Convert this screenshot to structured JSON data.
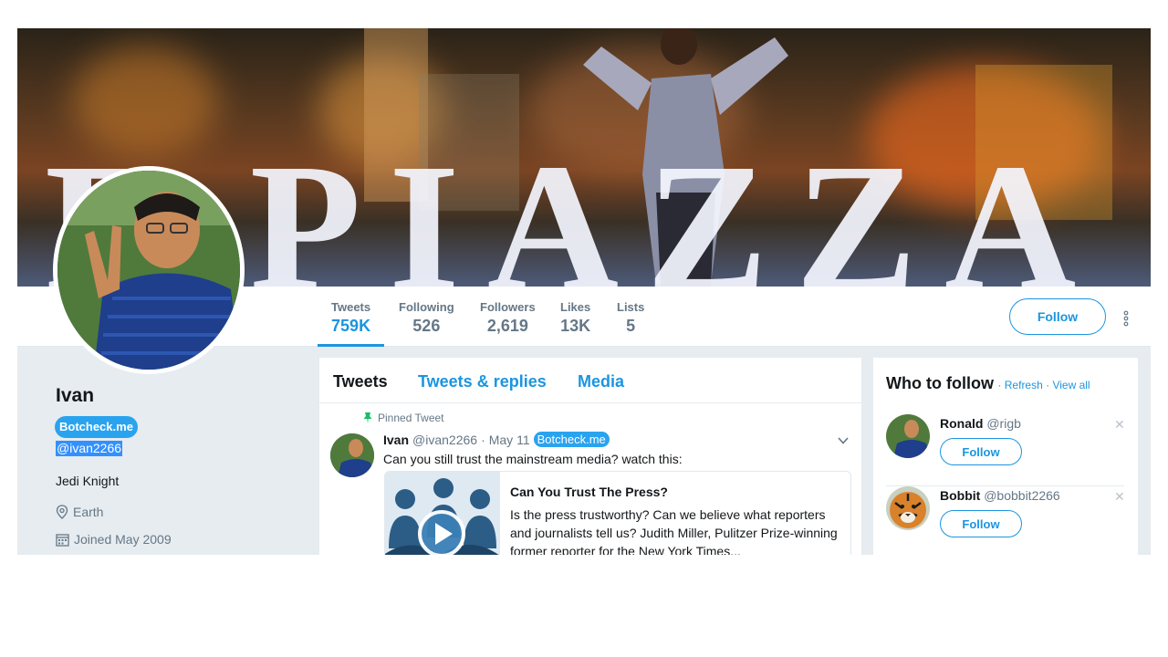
{
  "banner": {
    "sign_text": "F PIAZZA"
  },
  "nav": {
    "stats": [
      {
        "label": "Tweets",
        "value": "759K",
        "active": true
      },
      {
        "label": "Following",
        "value": "526"
      },
      {
        "label": "Followers",
        "value": "2,619"
      },
      {
        "label": "Likes",
        "value": "13K"
      },
      {
        "label": "Lists",
        "value": "5"
      }
    ],
    "follow_label": "Follow",
    "more_icon": "vertical-dots-icon"
  },
  "profile": {
    "name": "Ivan",
    "badge": "Botcheck.me",
    "handle": "@ivan2266",
    "bio": "Jedi Knight",
    "location": "Earth",
    "location_icon": "location-pin-icon",
    "joined": "Joined May 2009",
    "joined_icon": "calendar-icon"
  },
  "timeline": {
    "tabs": [
      {
        "label": "Tweets",
        "active": true
      },
      {
        "label": "Tweets & replies"
      },
      {
        "label": "Media"
      }
    ],
    "tweet": {
      "pinned_label": "Pinned Tweet",
      "name": "Ivan",
      "handle": "@ivan2266",
      "separator": "·",
      "date": "May 11",
      "badge": "Botcheck.me",
      "text": "Can you still trust the mainstream media? watch this:",
      "card": {
        "title": "Can You Trust The Press?",
        "description": "Is the press trustworthy? Can we believe what reporters and journalists tell us? Judith Miller, Pulitzer Prize-winning former reporter for the New York Times..."
      }
    }
  },
  "who_to_follow": {
    "title": "Who to follow",
    "refresh": "Refresh",
    "view_all": "View all",
    "dot": " · ",
    "items": [
      {
        "name": "Ronald",
        "handle": "@rigb",
        "follow_label": "Follow"
      },
      {
        "name": "Bobbit",
        "handle": "@bobbit2266",
        "follow_label": "Follow"
      }
    ]
  },
  "colors": {
    "accent": "#1b95e0",
    "badge": "#2aa3ef",
    "muted": "#657786",
    "background": "#e6ecf0"
  }
}
